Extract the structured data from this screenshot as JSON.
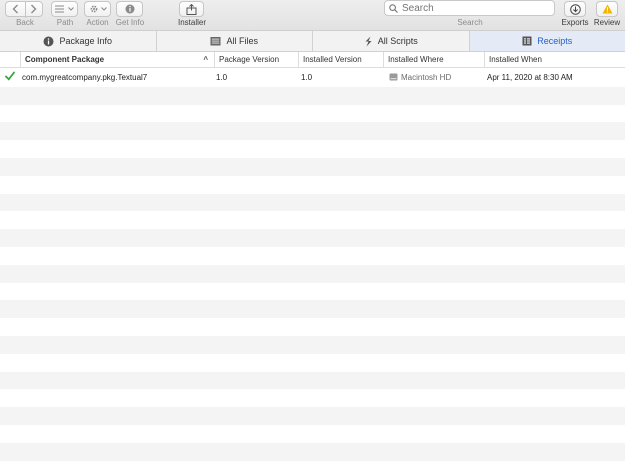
{
  "toolbar": {
    "back_label": "Back",
    "path_label": "Path",
    "action_label": "Action",
    "getinfo_label": "Get Info",
    "installer_label": "Installer",
    "search_placeholder": "Search",
    "search_label": "Search",
    "exports_label": "Exports",
    "review_label": "Review"
  },
  "tabs": [
    {
      "label": "Package Info",
      "icon": "info-circle-icon"
    },
    {
      "label": "All Files",
      "icon": "files-icon"
    },
    {
      "label": "All Scripts",
      "icon": "scripts-icon"
    },
    {
      "label": "Receipts",
      "icon": "receipts-icon",
      "active": true
    }
  ],
  "table": {
    "columns": [
      "Component Package",
      "Package Version",
      "Installed Version",
      "Installed Where",
      "Installed When"
    ],
    "rows": [
      {
        "status": "check-icon",
        "component": "com.mygreatcompany.pkg.Textual7",
        "package_version": "1.0",
        "installed_version": "1.0",
        "installed_where": "Macintosh HD",
        "installed_when": "Apr 11, 2020 at 8:30 AM"
      }
    ]
  },
  "colors": {
    "accent": "#2563c9",
    "check": "#3aa53a",
    "warning": "#f5b400"
  }
}
